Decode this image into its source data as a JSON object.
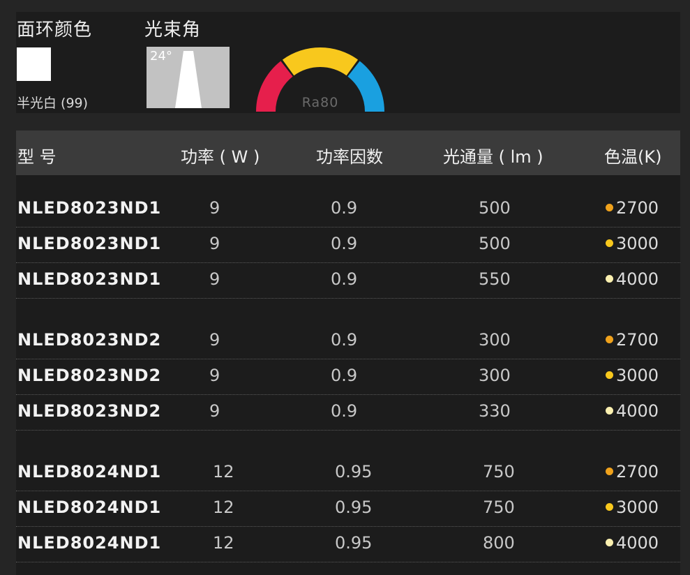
{
  "spec": {
    "ring_color_label": "面环颜色",
    "ring_color_value": "半光白 (99)",
    "ring_color_hex": "#ffffff",
    "beam_angle_label": "光束角",
    "beam_angle_value": "24°",
    "cri_value": "Ra80",
    "cri_arc_colors": [
      "#e61f4c",
      "#f8c81d",
      "#1aa0e0"
    ]
  },
  "table": {
    "headers": {
      "model": "型  号",
      "power": "功率 ( W )",
      "pf": "功率因数",
      "flux": "光通量 ( lm )",
      "cct": "色温(K)"
    },
    "dot_colors": {
      "2700": "#f0a21c",
      "3000": "#f8c81d",
      "4000": "#fbf0b0"
    },
    "rows": [
      {
        "model": "NLED8023ND1",
        "power": "9",
        "pf": "0.9",
        "flux": "500",
        "cct": "2700"
      },
      {
        "model": "NLED8023ND1",
        "power": "9",
        "pf": "0.9",
        "flux": "500",
        "cct": "3000"
      },
      {
        "model": "NLED8023ND1",
        "power": "9",
        "pf": "0.9",
        "flux": "550",
        "cct": "4000"
      },
      {
        "model": "NLED8023ND2",
        "power": "9",
        "pf": "0.9",
        "flux": "300",
        "cct": "2700"
      },
      {
        "model": "NLED8023ND2",
        "power": "9",
        "pf": "0.9",
        "flux": "300",
        "cct": "3000"
      },
      {
        "model": "NLED8023ND2",
        "power": "9",
        "pf": "0.9",
        "flux": "330",
        "cct": "4000"
      },
      {
        "model": "NLED8024ND1",
        "power": "12",
        "pf": "0.95",
        "flux": "750",
        "cct": "2700"
      },
      {
        "model": "NLED8024ND1",
        "power": "12",
        "pf": "0.95",
        "flux": "750",
        "cct": "3000"
      },
      {
        "model": "NLED8024ND1",
        "power": "12",
        "pf": "0.95",
        "flux": "800",
        "cct": "4000"
      }
    ]
  }
}
